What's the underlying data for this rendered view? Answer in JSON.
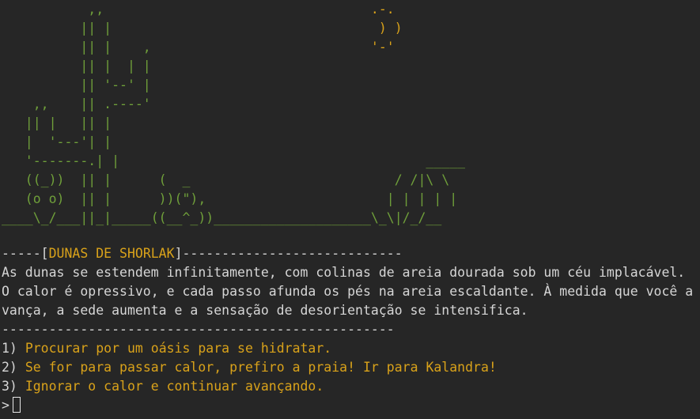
{
  "scene_title": "DUNAS DE SHORLAK",
  "header_left": "-----[",
  "header_right": "]----------------------------",
  "description": [
    "As dunas se estendem infinitamente, com colinas de areia dourada sob um céu implacável.",
    "O calor é opressivo, e cada passo afunda os pés na areia escaldante. À medida que você a",
    "vança, a sede aumenta e a sensação de desorientação se intensifica."
  ],
  "separator": "--------------------------------------------------",
  "options": [
    {
      "number": "1)",
      "text": "Procurar por um oásis para se hidratar."
    },
    {
      "number": "2)",
      "text": "Se for para passar calor, prefiro a praia! Ir para Kalandra!"
    },
    {
      "number": "3)",
      "text": "Ignorar o calor e continuar avançando."
    }
  ],
  "prompt": ">",
  "colors": {
    "background": "#262626",
    "text": "#d6d6d6",
    "highlight": "#d9a21a",
    "art": "#6f9f3a"
  }
}
